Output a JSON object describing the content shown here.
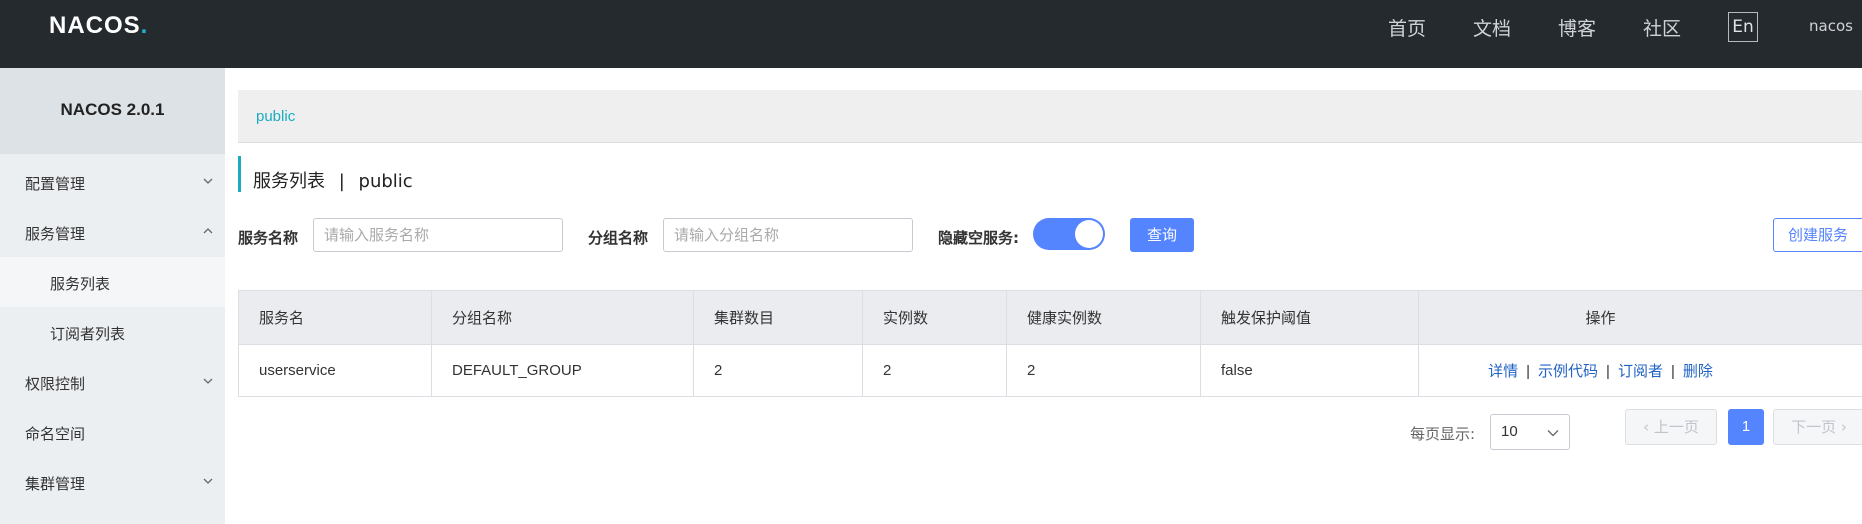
{
  "app": {
    "logo": "NACOS.",
    "nav": [
      "首页",
      "文档",
      "博客",
      "社区"
    ],
    "lang_button": "En",
    "user": "nacos"
  },
  "sidebar": {
    "title": "NACOS 2.0.1",
    "items": [
      {
        "label": "配置管理",
        "icon": "chevron-down-icon"
      },
      {
        "label": "服务管理",
        "icon": "chevron-up-icon"
      },
      {
        "label": "服务列表"
      },
      {
        "label": "订阅者列表"
      },
      {
        "label": "权限控制",
        "icon": "chevron-down-icon"
      },
      {
        "label": "命名空间"
      },
      {
        "label": "集群管理",
        "icon": "chevron-down-icon"
      }
    ]
  },
  "breadcrumb": {
    "namespace": "public"
  },
  "page": {
    "title": "服务列表",
    "separator": "|",
    "namespace": "public"
  },
  "filters": {
    "service_name_label": "服务名称",
    "service_name_placeholder": "请输入服务名称",
    "group_name_label": "分组名称",
    "group_name_placeholder": "请输入分组名称",
    "hide_empty_label": "隐藏空服务:",
    "hide_empty_on": true,
    "query_button": "查询",
    "create_button": "创建服务"
  },
  "table": {
    "headers": [
      "服务名",
      "分组名称",
      "集群数目",
      "实例数",
      "健康实例数",
      "触发保护阈值",
      "操作"
    ],
    "rows": [
      {
        "service": "userservice",
        "group": "DEFAULT_GROUP",
        "clusters": "2",
        "instances": "2",
        "healthy": "2",
        "threshold": "false",
        "actions": [
          "详情",
          "示例代码",
          "订阅者",
          "删除"
        ]
      }
    ]
  },
  "pagination": {
    "page_size_label": "每页显示:",
    "page_size": "10",
    "prev_label": "上一页",
    "next_label": "下一页",
    "current_page": "1"
  },
  "colors": {
    "topbar": "#252a2f",
    "accent_teal": "#1aabc1",
    "primary_blue": "#5584ff",
    "link_blue": "#2263c5"
  }
}
